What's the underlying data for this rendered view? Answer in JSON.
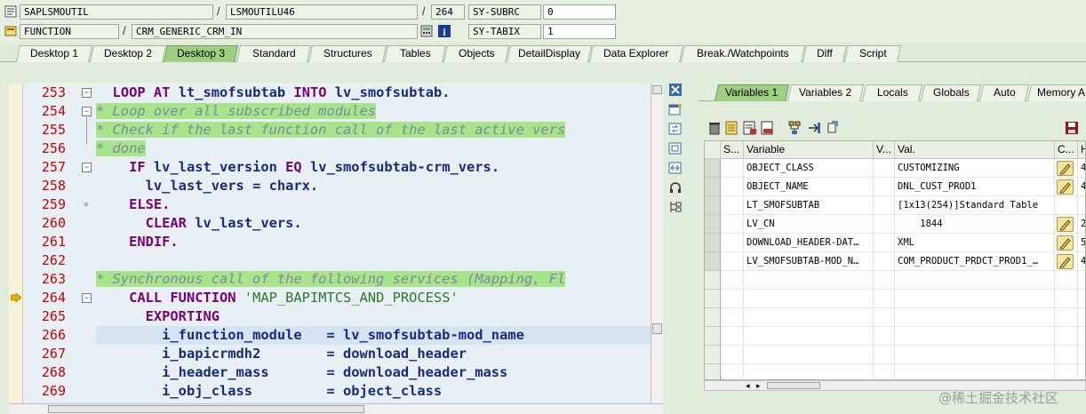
{
  "header": {
    "program": "SAPLSMOUTIL",
    "include": "LSMOUTILU46",
    "line": "264",
    "sysfield1_name": "SY-SUBRC",
    "sysfield1_value": "0",
    "event_type": "FUNCTION",
    "event_name": "CRM_GENERIC_CRM_IN",
    "sysfield2_name": "SY-TABIX",
    "sysfield2_value": "1"
  },
  "tabs": [
    "Desktop 1",
    "Desktop 2",
    "Desktop 3",
    "Standard",
    "Structures",
    "Tables",
    "Objects",
    "DetailDisplay",
    "Data Explorer",
    "Break./Watchpoints",
    "Diff",
    "Script"
  ],
  "active_tab": "Desktop 3",
  "code": {
    "line_numbers": [
      "253",
      "254",
      "255",
      "256",
      "257",
      "258",
      "259",
      "260",
      "261",
      "262",
      "263",
      "264",
      "265",
      "266",
      "267",
      "268",
      "269"
    ],
    "lines": [
      {
        "pre": "  ",
        "kw": "LOOP AT",
        "rest": " lt_smofsubtab ",
        "kw2": "INTO",
        "rest2": " lv_smofsubtab."
      },
      {
        "comment": "* Loop over all subscribed modules"
      },
      {
        "comment": "* Check if the last function call of the last active vers"
      },
      {
        "comment": "* done"
      },
      {
        "pre": "    ",
        "kw": "IF",
        "rest": " lv_last_version ",
        "kw2": "EQ",
        "rest2": " lv_smofsubtab-crm_vers."
      },
      {
        "pre": "      ",
        "rest": "lv_last_vers = charx."
      },
      {
        "pre": "    ",
        "kw": "ELSE."
      },
      {
        "pre": "      ",
        "kw": "CLEAR",
        "rest": " lv_last_vers."
      },
      {
        "pre": "    ",
        "kw": "ENDIF."
      },
      {
        "pre": ""
      },
      {
        "comment": "* Synchronous call of the following services (Mapping, Fl"
      },
      {
        "pre": "    ",
        "kw": "CALL FUNCTION",
        "str": " 'MAP_BAPIMTCS_AND_PROCESS'"
      },
      {
        "pre": "      ",
        "kw": "EXPORTING"
      },
      {
        "pre": "        ",
        "rest": "i_function_module   = lv_smofsubtab-mod_name"
      },
      {
        "pre": "        ",
        "rest": "i_bapicrmdh2        = download_header"
      },
      {
        "pre": "        ",
        "rest": "i_header_mass       = download_header_mass"
      },
      {
        "pre": "        ",
        "rest": "i_obj_class         = object_class"
      }
    ],
    "current_line": "264"
  },
  "right_tabs": [
    "Variables 1",
    "Variables 2",
    "Locals",
    "Globals",
    "Auto",
    "Memory A"
  ],
  "active_right_tab": "Variables 1",
  "grid": {
    "headers": [
      "S...",
      "Variable",
      "V...",
      "Val.",
      "C...",
      "H"
    ],
    "rows": [
      {
        "variable": "OBJECT_CLASS",
        "value": "CUSTOMIZING",
        "edit": true,
        "h": "4"
      },
      {
        "variable": "OBJECT_NAME",
        "value": "DNL_CUST_PROD1",
        "edit": true,
        "h": "4"
      },
      {
        "variable": "LT_SMOFSUBTAB",
        "value": "[1x13(254)]Standard Table",
        "edit": false,
        "h": ""
      },
      {
        "variable": "LV_CN",
        "value": "    1844",
        "edit": true,
        "h": "2"
      },
      {
        "variable": "DOWNLOAD_HEADER-DAT…",
        "value": "XML",
        "edit": true,
        "h": "5"
      },
      {
        "variable": "LV_SMOFSUBTAB-MOD_N…",
        "value": "COM_PRODUCT_PRDCT_PROD1_…",
        "edit": true,
        "h": "4"
      }
    ]
  },
  "watermark": "@稀土掘金技术社区",
  "colors": {
    "active_tab": "#9fcf82",
    "comment_highlight": "#a7e48a",
    "line_number": "#d00000",
    "keyword": "#7a007a"
  }
}
